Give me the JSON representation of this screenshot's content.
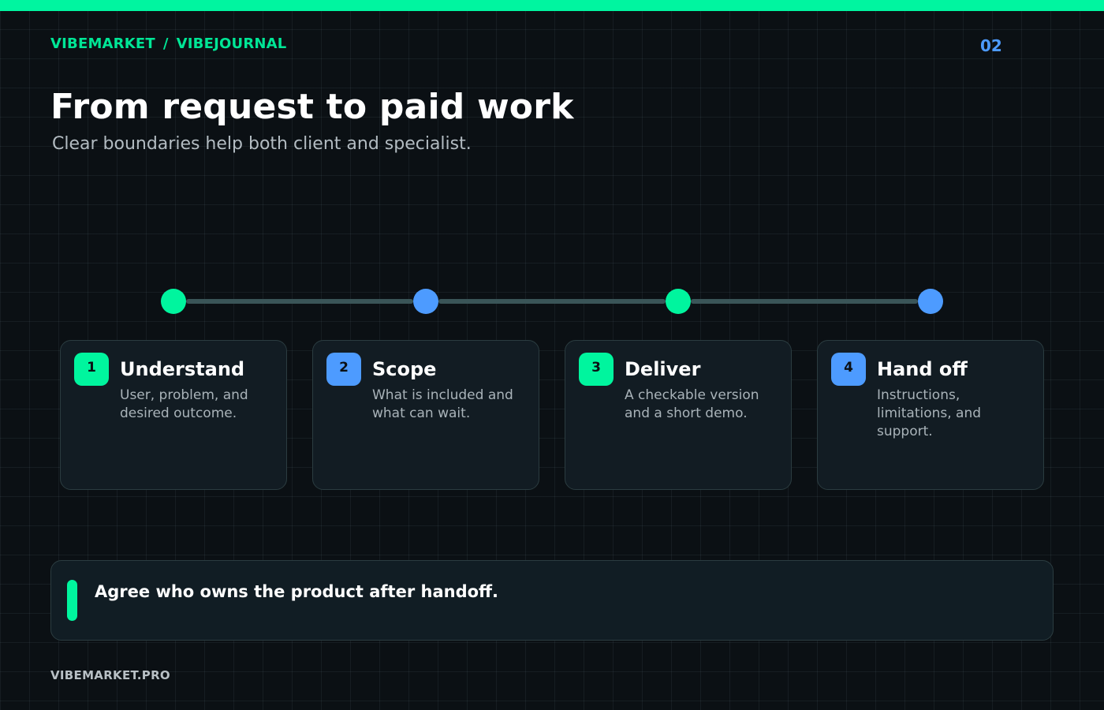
{
  "colors": {
    "accent_green": "#00f59e",
    "accent_blue": "#4d9bff",
    "background": "#0b1014",
    "card_background": "#121c23"
  },
  "header": {
    "breadcrumb": [
      "VIBEMARKET",
      "VIBEJOURNAL"
    ],
    "breadcrumb_separator": "/",
    "page_number": "02"
  },
  "slide": {
    "title": "From request to paid work",
    "subtitle": "Clear boundaries help both client and specialist."
  },
  "steps": [
    {
      "number": "1",
      "title": "Understand",
      "description": "User, problem, and desired outcome.",
      "color": "green"
    },
    {
      "number": "2",
      "title": "Scope",
      "description": "What is included and what can wait.",
      "color": "blue"
    },
    {
      "number": "3",
      "title": "Deliver",
      "description": "A checkable version and a short demo.",
      "color": "green"
    },
    {
      "number": "4",
      "title": "Hand off",
      "description": "Instructions, limitations, and support.",
      "color": "blue"
    }
  ],
  "callout": {
    "text": "Agree who owns the product after handoff."
  },
  "footer": {
    "site": "VIBEMARKET.PRO"
  }
}
